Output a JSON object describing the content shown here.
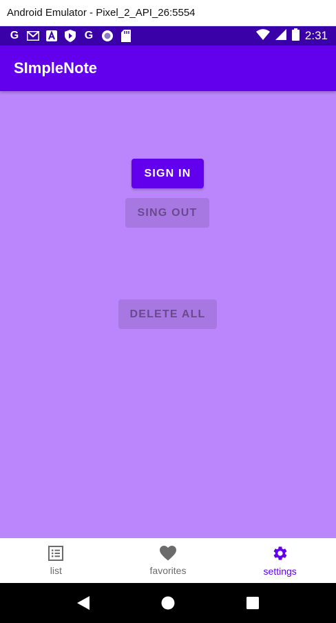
{
  "window": {
    "title": "Android Emulator - Pixel_2_API_26:5554"
  },
  "status_bar": {
    "time": "2:31",
    "notification_icons": [
      "google-g-icon",
      "gmail-icon",
      "font-a-icon",
      "shield-play-icon",
      "google-g-icon",
      "record-circle-icon",
      "sd-card-icon"
    ],
    "background": "#3a01a8"
  },
  "app_bar": {
    "title": "SImpleNote",
    "background": "#6200ee"
  },
  "content": {
    "background": "#bb86fc",
    "sign_in_label": "SIGN IN",
    "sign_out_label": "SING OUT",
    "delete_all_label": "DELETE ALL"
  },
  "bottom_nav": {
    "items": [
      {
        "label": "list",
        "icon": "list-icon",
        "active": false
      },
      {
        "label": "favorites",
        "icon": "heart-icon",
        "active": false
      },
      {
        "label": "settings",
        "icon": "gear-icon",
        "active": true
      }
    ],
    "active_color": "#6200ee"
  },
  "system_nav": {
    "buttons": [
      "back-icon",
      "home-icon",
      "recents-icon"
    ]
  }
}
